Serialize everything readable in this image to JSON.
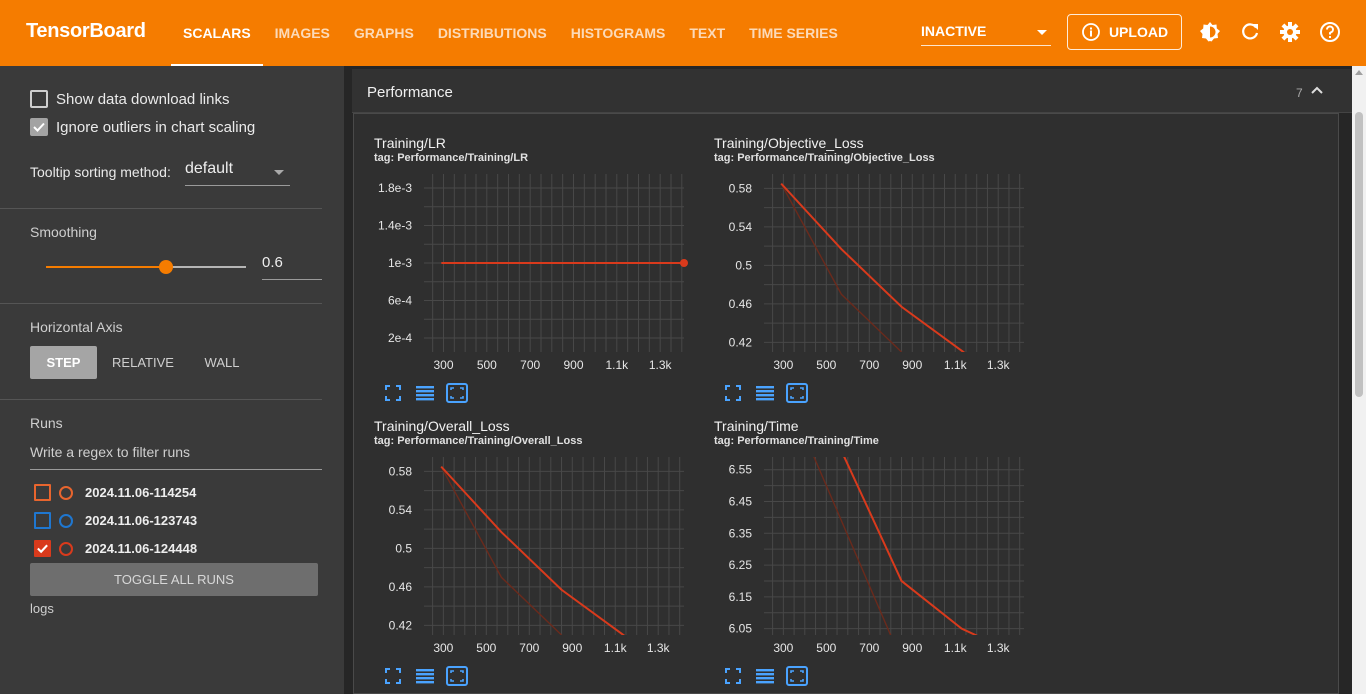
{
  "header": {
    "brand": "TensorBoard",
    "tabs": [
      {
        "label": "SCALARS",
        "active": true
      },
      {
        "label": "IMAGES",
        "active": false
      },
      {
        "label": "GRAPHS",
        "active": false
      },
      {
        "label": "DISTRIBUTIONS",
        "active": false
      },
      {
        "label": "HISTOGRAMS",
        "active": false
      },
      {
        "label": "TEXT",
        "active": false
      },
      {
        "label": "TIME SERIES",
        "active": false
      }
    ],
    "status": "INACTIVE",
    "upload_label": "UPLOAD",
    "accent_color": "#f57c00"
  },
  "sidebar": {
    "show_download_label": "Show data download links",
    "show_download_checked": false,
    "ignore_outliers_label": "Ignore outliers in chart scaling",
    "ignore_outliers_checked": true,
    "tooltip_label": "Tooltip sorting method:",
    "tooltip_value": "default",
    "smoothing_label": "Smoothing",
    "smoothing_value": "0.6",
    "smoothing_fraction": 0.6,
    "horizontal_axis_label": "Horizontal Axis",
    "axis_options": [
      "STEP",
      "RELATIVE",
      "WALL"
    ],
    "axis_selected": "STEP",
    "runs_label": "Runs",
    "filter_placeholder": "Write a regex to filter runs",
    "runs": [
      {
        "name": "2024.11.06-114254",
        "color": "#e8652e",
        "checked": false
      },
      {
        "name": "2024.11.06-123743",
        "color": "#1f77d0",
        "checked": false
      },
      {
        "name": "2024.11.06-124448",
        "color": "#d93a1c",
        "checked": true
      }
    ],
    "toggle_label": "TOGGLE ALL RUNS",
    "logs_label": "logs"
  },
  "main": {
    "group_title": "Performance",
    "group_count": "7"
  },
  "chart_data": [
    {
      "type": "line",
      "title": "Training/LR",
      "tag": "tag: Performance/Training/LR",
      "xticks": [
        "300",
        "500",
        "700",
        "900",
        "1.1k",
        "1.3k"
      ],
      "xtick_values": [
        300,
        500,
        700,
        900,
        1100,
        1300
      ],
      "yticks": [
        "1.8e-3",
        "1.4e-3",
        "1e-3",
        "6e-4",
        "2e-4"
      ],
      "ytick_values": [
        0.0018,
        0.0014,
        0.001,
        0.0006,
        0.0002
      ],
      "xlim": [
        210,
        1410
      ],
      "ylim": [
        5e-05,
        0.00195
      ],
      "series": [
        {
          "x": [
            290,
            1410
          ],
          "y": [
            0.001,
            0.001
          ],
          "color": "#d93a1c",
          "smoothed": true,
          "end_marker": true
        }
      ]
    },
    {
      "type": "line",
      "title": "Training/Objective_Loss",
      "tag": "tag: Performance/Training/Objective_Loss",
      "xticks": [
        "300",
        "500",
        "700",
        "900",
        "1.1k",
        "1.3k"
      ],
      "xtick_values": [
        300,
        500,
        700,
        900,
        1100,
        1300
      ],
      "yticks": [
        "0.58",
        "0.54",
        "0.5",
        "0.46",
        "0.42"
      ],
      "ytick_values": [
        0.58,
        0.54,
        0.5,
        0.46,
        0.42
      ],
      "xlim": [
        210,
        1420
      ],
      "ylim": [
        0.41,
        0.595
      ],
      "series": [
        {
          "x": [
            290,
            570,
            850,
            1230
          ],
          "y": [
            0.585,
            0.517,
            0.457,
            0.395
          ],
          "color": "#d93a1c",
          "smoothed": true
        },
        {
          "x": [
            290,
            570,
            850
          ],
          "y": [
            0.585,
            0.47,
            0.41
          ],
          "color": "#6a2a1c",
          "smoothed": false
        }
      ]
    },
    {
      "type": "line",
      "title": "Training/Overall_Loss",
      "tag": "tag: Performance/Training/Overall_Loss",
      "xticks": [
        "300",
        "500",
        "700",
        "900",
        "1.1k",
        "1.3k"
      ],
      "xtick_values": [
        300,
        500,
        700,
        900,
        1100,
        1300
      ],
      "yticks": [
        "0.58",
        "0.54",
        "0.5",
        "0.46",
        "0.42"
      ],
      "ytick_values": [
        0.58,
        0.54,
        0.5,
        0.46,
        0.42
      ],
      "xlim": [
        210,
        1420
      ],
      "ylim": [
        0.41,
        0.595
      ],
      "series": [
        {
          "x": [
            290,
            570,
            850,
            1230
          ],
          "y": [
            0.585,
            0.517,
            0.457,
            0.395
          ],
          "color": "#d93a1c",
          "smoothed": true
        },
        {
          "x": [
            290,
            570,
            850
          ],
          "y": [
            0.585,
            0.47,
            0.41
          ],
          "color": "#6a2a1c",
          "smoothed": false
        }
      ]
    },
    {
      "type": "line",
      "title": "Training/Time",
      "tag": "tag: Performance/Training/Time",
      "xticks": [
        "300",
        "500",
        "700",
        "900",
        "1.1k",
        "1.3k"
      ],
      "xtick_values": [
        300,
        500,
        700,
        900,
        1100,
        1300
      ],
      "yticks": [
        "6.55",
        "6.45",
        "6.35",
        "6.25",
        "6.15",
        "6.05"
      ],
      "ytick_values": [
        6.55,
        6.45,
        6.35,
        6.25,
        6.15,
        6.05
      ],
      "xlim": [
        210,
        1420
      ],
      "ylim": [
        6.03,
        6.59
      ],
      "series": [
        {
          "x": [
            570,
            850,
            1130,
            1290
          ],
          "y": [
            6.61,
            6.2,
            6.05,
            6.0
          ],
          "color": "#d93a1c",
          "smoothed": true
        },
        {
          "x": [
            430,
            850
          ],
          "y": [
            6.61,
            5.95
          ],
          "color": "#6a2a1c",
          "smoothed": false
        }
      ]
    }
  ]
}
